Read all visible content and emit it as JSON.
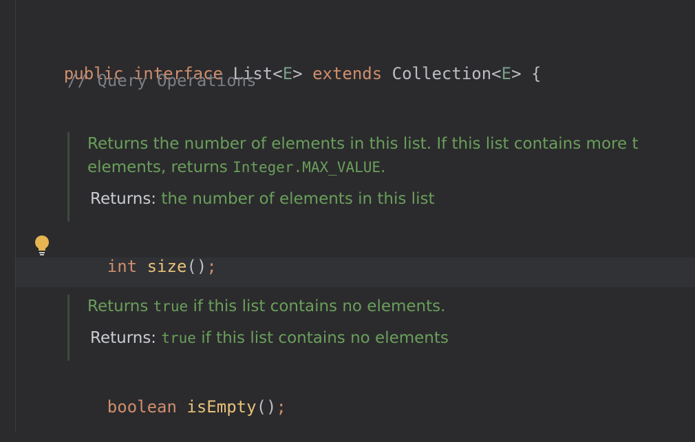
{
  "code": {
    "line1": {
      "kw_public": "public",
      "kw_interface": "interface",
      "type_list": "List",
      "lt1": "<",
      "tparam1": "E",
      "gt1": ">",
      "kw_extends": "extends",
      "type_collection": "Collection",
      "lt2": "<",
      "tparam2": "E",
      "gt2": ">",
      "brace": "{"
    },
    "comment": "// Query Operations",
    "size_decl": {
      "type": "int",
      "name": "size",
      "parens": "()",
      "semi": ";"
    },
    "isempty_decl": {
      "type": "boolean",
      "name": "isEmpty",
      "parens": "()",
      "semi": ";"
    }
  },
  "doc_size": {
    "line1": "Returns the number of elements in this list. If this list contains more t",
    "line2_prefix": "elements, returns ",
    "line2_code": "Integer.MAX_VALUE",
    "line2_suffix": ".",
    "returns_label": "Returns:",
    "returns_text": "the number of elements in this list"
  },
  "doc_isempty": {
    "line1_prefix": "Returns ",
    "line1_code": "true",
    "line1_suffix": " if this list contains no elements.",
    "returns_label": "Returns:",
    "returns_code": "true",
    "returns_text": " if this list contains no elements"
  },
  "icons": {
    "intention": "lightbulb-icon"
  },
  "colors": {
    "background": "#2b2b2d",
    "keyword": "#cf8e6d",
    "method": "#e8c17a",
    "doc": "#6a9f5b",
    "comment": "#7a7e85"
  }
}
